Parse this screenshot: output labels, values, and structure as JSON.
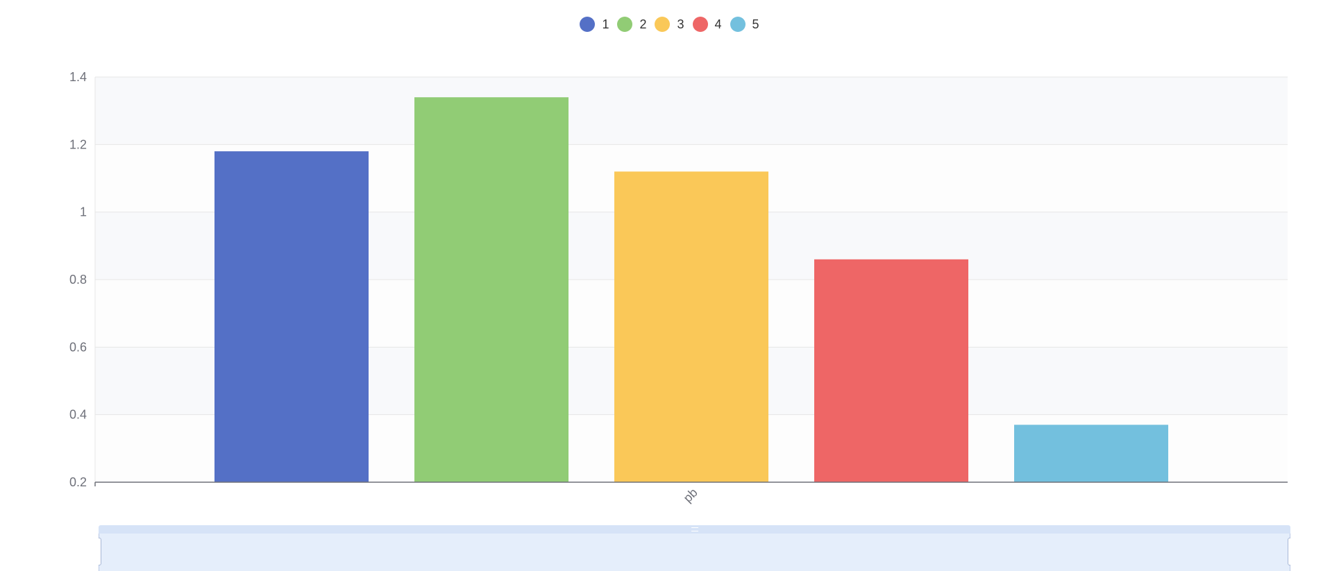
{
  "chart_data": {
    "type": "bar",
    "categories": [
      "pb"
    ],
    "series": [
      {
        "name": "1",
        "values": [
          1.18
        ],
        "color": "#5470c6"
      },
      {
        "name": "2",
        "values": [
          1.34
        ],
        "color": "#91cc75"
      },
      {
        "name": "3",
        "values": [
          1.12
        ],
        "color": "#fac858"
      },
      {
        "name": "4",
        "values": [
          0.86
        ],
        "color": "#ee6666"
      },
      {
        "name": "5",
        "values": [
          0.37
        ],
        "color": "#73c0de"
      }
    ],
    "ylim": [
      0.2,
      1.4
    ],
    "yticks": [
      "0.2",
      "0.4",
      "0.6",
      "0.8",
      "1",
      "1.2",
      "1.4"
    ],
    "legend_position": "top-center",
    "split_area": true,
    "grid": true
  },
  "datazoom": {
    "start": 0,
    "end": 100
  }
}
